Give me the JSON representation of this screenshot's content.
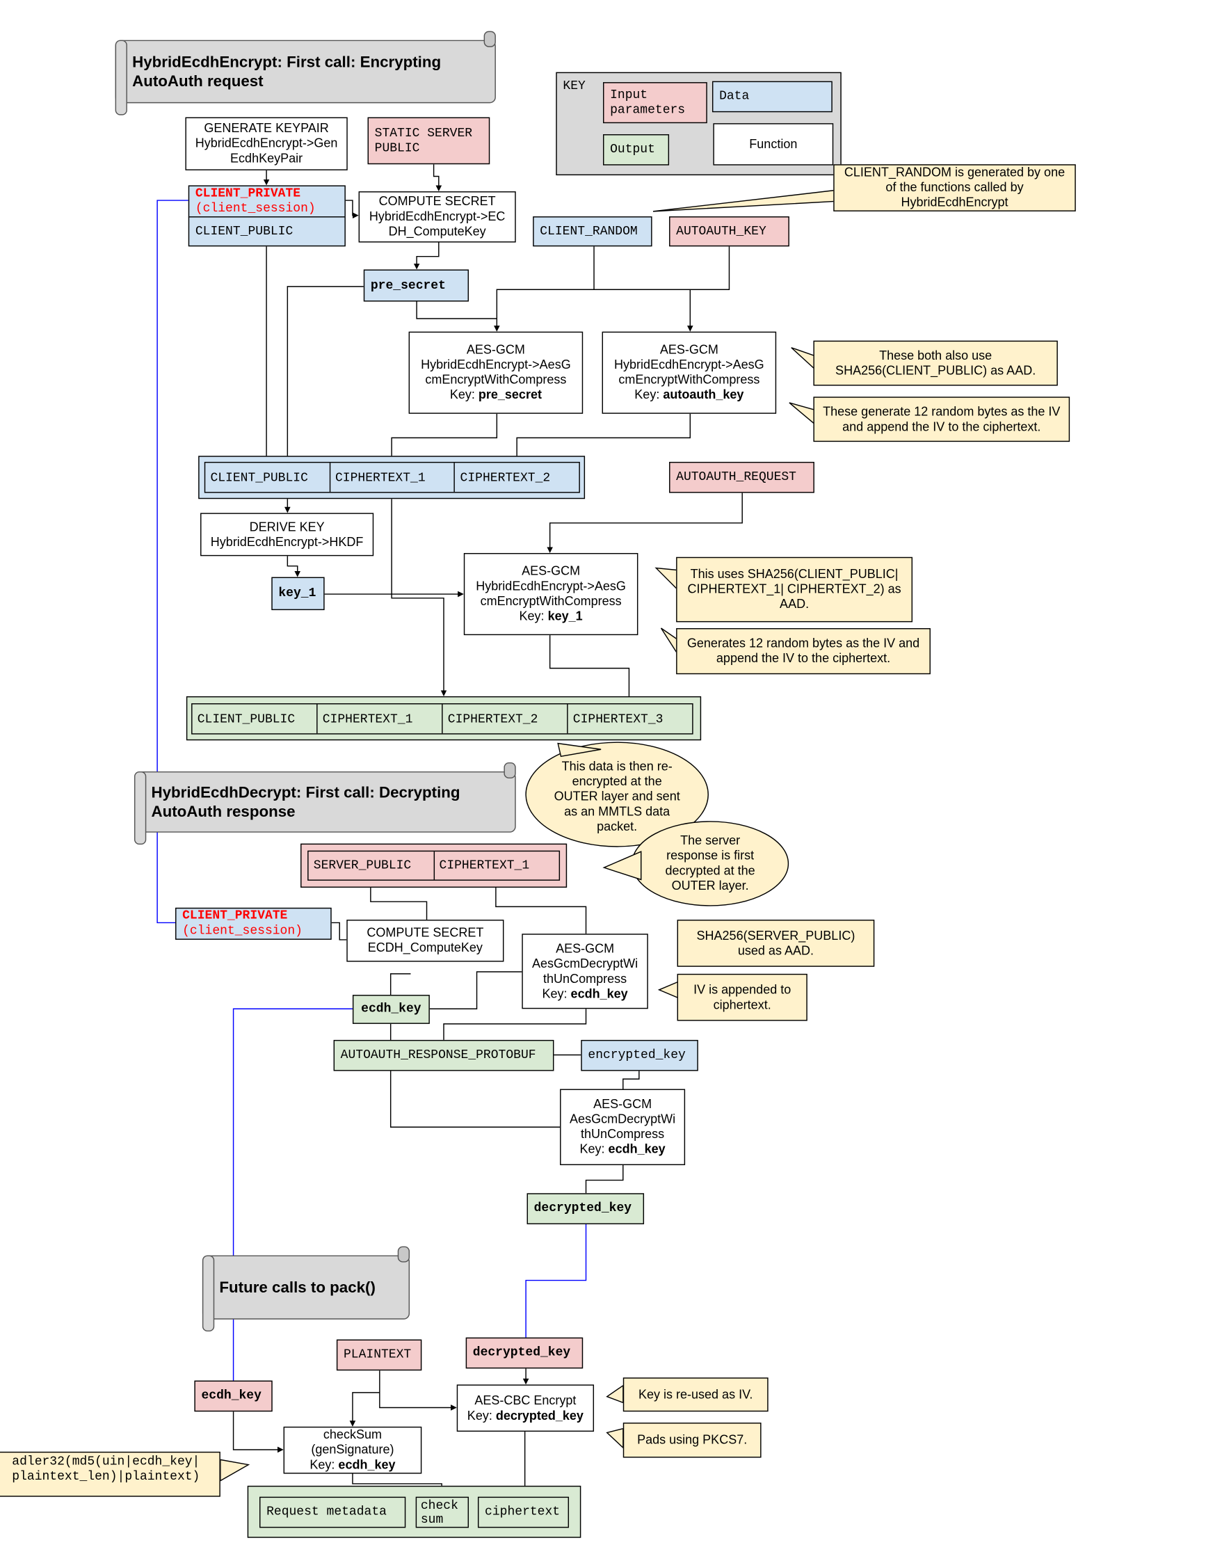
{
  "titles": {
    "encrypt": "HybridEcdhEncrypt: First call: Encrypting AutoAuth request",
    "decrypt": "HybridEcdhDecrypt: First call: Decrypting AutoAuth response",
    "future": "Future calls to pack()"
  },
  "key": {
    "label": "KEY",
    "input": "Input parameters",
    "data": "Data",
    "output": "Output",
    "function": "Function"
  },
  "colors": {
    "input": "#f4cccc",
    "data": "#cfe2f3",
    "output": "#d9ead3",
    "note": "#fff2cc",
    "scroll": "#d9d9d9",
    "session_link": "#0000ff"
  },
  "encrypt": {
    "generate_keypair": [
      "GENERATE KEYPAIR",
      "HybridEcdhEncrypt->Gen",
      "EcdhKeyPair"
    ],
    "static_server_public": "STATIC SERVER PUBLIC",
    "client_private": "CLIENT_PRIVATE",
    "client_session": "(client_session)",
    "client_public": "CLIENT_PUBLIC",
    "compute_secret": [
      "COMPUTE SECRET",
      "HybridEcdhEncrypt->EC",
      "DH_ComputeKey"
    ],
    "client_random": "CLIENT_RANDOM",
    "autoauth_key": "AUTOAUTH_KEY",
    "pre_secret": "pre_secret",
    "aes1": {
      "lines": [
        "AES-GCM",
        "HybridEcdhEncrypt->AesG",
        "cmEncryptWithCompress"
      ],
      "key_label": "Key: ",
      "key": "pre_secret"
    },
    "aes2": {
      "lines": [
        "AES-GCM",
        "HybridEcdhEncrypt->AesG",
        "cmEncryptWithCompress"
      ],
      "key_label": "Key: ",
      "key": "autoauth_key"
    },
    "row1": [
      "CLIENT_PUBLIC",
      "CIPHERTEXT_1",
      "CIPHERTEXT_2"
    ],
    "autoauth_request": "AUTOAUTH_REQUEST",
    "derive_key": [
      "DERIVE KEY",
      "HybridEcdhEncrypt->HKDF"
    ],
    "key_1": "key_1",
    "aes3": {
      "lines": [
        "AES-GCM",
        "HybridEcdhEncrypt->AesG",
        "cmEncryptWithCompress"
      ],
      "key_label": "Key: ",
      "key": "key_1"
    },
    "row2": [
      "CLIENT_PUBLIC",
      "CIPHERTEXT_1",
      "CIPHERTEXT_2",
      "CIPHERTEXT_3"
    ]
  },
  "notes": {
    "client_random": "CLIENT_RANDOM is generated by one of the functions called by HybridEcdhEncrypt",
    "aad_both": "These both also use SHA256(CLIENT_PUBLIC) as AAD.",
    "iv_both": "These generate 12 random bytes as the IV and append the IV to the ciphertext.",
    "aad_key1": "This uses SHA256(CLIENT_PUBLIC| CIPHERTEXT_1| CIPHERTEXT_2) as AAD.",
    "iv_key1": "Generates 12 random bytes as the IV and append the IV to the ciphertext.",
    "reencrypted": "This data is then re-encrypted at the OUTER layer and sent as an MMTLS data packet.",
    "server_decrypted": "The server response is first decrypted at the OUTER layer.",
    "aad_server": "SHA256(SERVER_PUBLIC) used as AAD.",
    "iv_appended": "IV is appended to ciphertext.",
    "key_iv": "Key is re-used as IV.",
    "pkcs7": "Pads using PKCS7.",
    "adler": "adler32(md5(uin|ecdh_key| plaintext_len)|plaintext)"
  },
  "decrypt": {
    "row": [
      "SERVER_PUBLIC",
      "CIPHERTEXT_1"
    ],
    "client_private": "CLIENT_PRIVATE",
    "client_session": "(client_session)",
    "compute_secret": [
      "COMPUTE SECRET",
      "ECDH_ComputeKey"
    ],
    "aes1": {
      "lines": [
        "AES-GCM",
        "AesGcmDecryptWi",
        "thUnCompress"
      ],
      "key_label": "Key: ",
      "key": "ecdh_key"
    },
    "ecdh_key": "ecdh_key",
    "autoauth_response": "AUTOAUTH_RESPONSE_PROTOBUF",
    "encrypted_key": "encrypted_key",
    "aes2": {
      "lines": [
        "AES-GCM",
        "AesGcmDecryptWi",
        "thUnCompress"
      ],
      "key_label": "Key: ",
      "key": "ecdh_key"
    },
    "decrypted_key": "decrypted_key"
  },
  "pack": {
    "plaintext": "PLAINTEXT",
    "decrypted_key": "decrypted_key",
    "ecdh_key": "ecdh_key",
    "aes_cbc": {
      "line": "AES-CBC Encrypt",
      "key_label": "Key: ",
      "key": "decrypted_key"
    },
    "checksum": {
      "lines": [
        "checkSum",
        "(genSignature)"
      ],
      "key_label": "Key: ",
      "key": "ecdh_key"
    },
    "output": [
      "Request metadata",
      "check sum",
      "ciphertext"
    ]
  }
}
